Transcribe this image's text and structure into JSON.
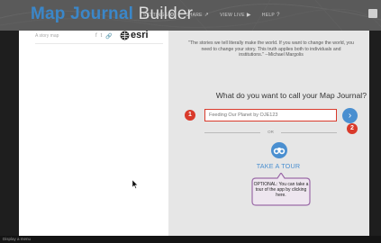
{
  "header": {
    "title_part1": "Map Journal",
    "title_part2": "Builder",
    "nav": [
      {
        "label": "SETTINGS",
        "icon": "⚙"
      },
      {
        "label": "SHARE",
        "icon": "↗"
      },
      {
        "label": "VIEW LIVE",
        "icon": "▶"
      },
      {
        "label": "HELP",
        "icon": "?"
      }
    ]
  },
  "left_panel": {
    "story_placeholder": "A story map",
    "share_icons": [
      "f",
      "t",
      "🔗"
    ],
    "logo_text": "esri"
  },
  "right_panel": {
    "quote": "\"The stories we tell literally make the world. If you want to change the world, you need to change your story. This truth applies both to individuals and institutions.\" --Michael Margolis",
    "question": "What do you want to call your Map Journal?",
    "input_value": "Feeding Our Planet by OJE123",
    "or_text": "OR",
    "tour_label": "TAKE A TOUR",
    "callout_text": "OPTIONAL: You can take a tour of the app by clicking here.",
    "badge1": "1",
    "badge2": "2"
  },
  "statusbar": {
    "text": "Display a menu"
  },
  "colors": {
    "accent_blue": "#4a8fd0",
    "title_blue": "#3b87c9",
    "highlight_red": "#d93a2b"
  }
}
